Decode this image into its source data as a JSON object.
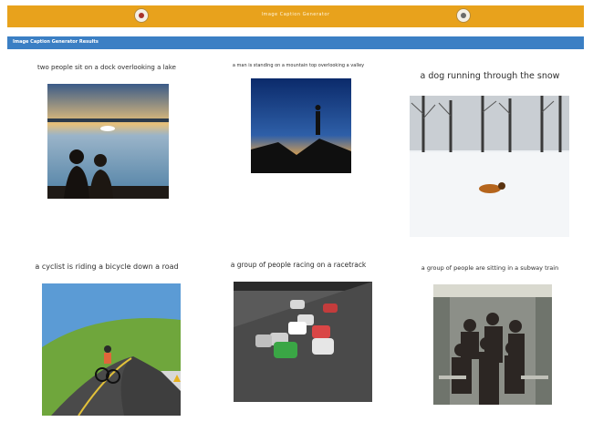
{
  "header": {
    "title": "Image Caption Generator",
    "left_logo": "emblem-icon",
    "right_logo": "seal-icon",
    "bar_color": "#e8a21c"
  },
  "subheader": {
    "title": "Image Caption Generator Results",
    "bar_color": "#3b7fc4"
  },
  "results": [
    {
      "caption": "two people sit on a dock overlooking a lake",
      "image": "couple-on-dock-photo"
    },
    {
      "caption": "a man is standing on a mountain top overlooking a valley",
      "image": "man-on-mountain-photo"
    },
    {
      "caption": "a dog running through the snow",
      "image": "dog-in-snow-photo"
    },
    {
      "caption": "a cyclist is riding a bicycle down a road",
      "image": "cyclist-on-road-photo"
    },
    {
      "caption": "a group of people racing on a racetrack",
      "image": "race-cars-photo"
    },
    {
      "caption": "a group of people are sitting in a subway train",
      "image": "people-in-subway-photo"
    }
  ]
}
